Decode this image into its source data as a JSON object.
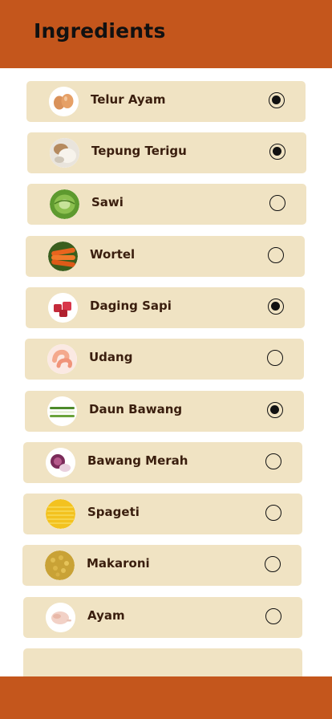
{
  "header": {
    "title": "Ingredients"
  },
  "ingredients": [
    {
      "label": "Telur Ayam",
      "icon": "egg-icon",
      "selected": true
    },
    {
      "label": "Tepung Terigu",
      "icon": "flour-icon",
      "selected": true
    },
    {
      "label": "Sawi",
      "icon": "mustard-greens-icon",
      "selected": false
    },
    {
      "label": "Wortel",
      "icon": "carrot-icon",
      "selected": false
    },
    {
      "label": "Daging Sapi",
      "icon": "beef-icon",
      "selected": true
    },
    {
      "label": "Udang",
      "icon": "shrimp-icon",
      "selected": false
    },
    {
      "label": "Daun Bawang",
      "icon": "scallion-icon",
      "selected": true
    },
    {
      "label": "Bawang Merah",
      "icon": "shallot-icon",
      "selected": false
    },
    {
      "label": "Spageti",
      "icon": "spaghetti-icon",
      "selected": false
    },
    {
      "label": "Makaroni",
      "icon": "macaroni-icon",
      "selected": false
    },
    {
      "label": "Ayam",
      "icon": "chicken-icon",
      "selected": false
    },
    {
      "label": "",
      "icon": "",
      "selected": false
    }
  ],
  "colors": {
    "header": "#c4561c",
    "card": "#f0e3c3",
    "text": "#3a1e0e"
  }
}
